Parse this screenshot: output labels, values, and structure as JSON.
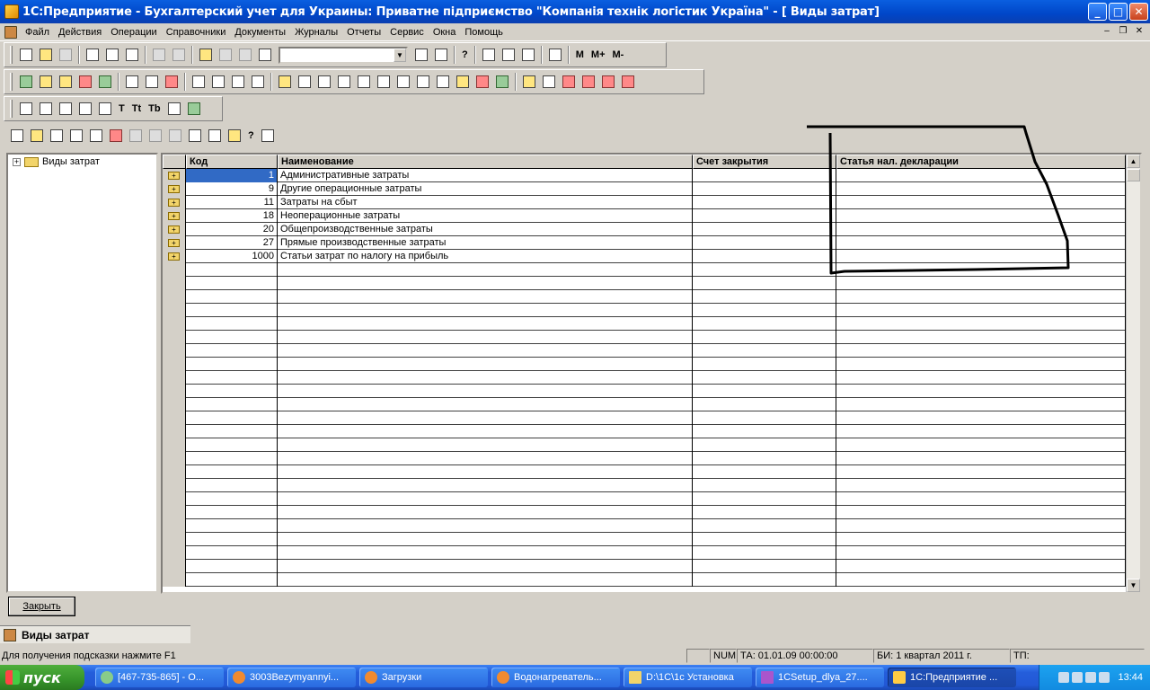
{
  "window": {
    "title": "1С:Предприятие - Бухгалтерский учет для Украины: Приватне підприємство \"Компанія  технік логістик  Україна\" - [ Виды затрат]",
    "min": "_",
    "max": "□",
    "close": "✕"
  },
  "menu": [
    "Файл",
    "Действия",
    "Операции",
    "Справочники",
    "Документы",
    "Журналы",
    "Отчеты",
    "Сервис",
    "Окна",
    "Помощь"
  ],
  "toolbar": {
    "m_label": "M",
    "mplus_label": "M+",
    "mminus_label": "M-",
    "help_label": "?",
    "text_labels": [
      "T",
      "Tt",
      "Tb"
    ]
  },
  "tree": {
    "root": "Виды затрат",
    "expander": "+"
  },
  "grid": {
    "columns": [
      "Код",
      "Наименование",
      "Счет закрытия",
      "Статья нал. декларации"
    ],
    "rows": [
      {
        "code": "1",
        "name": "Административные затраты",
        "account": "",
        "article": ""
      },
      {
        "code": "9",
        "name": "Другие операционные затраты",
        "account": "",
        "article": ""
      },
      {
        "code": "11",
        "name": "Затраты на сбыт",
        "account": "",
        "article": ""
      },
      {
        "code": "18",
        "name": "Неоперационные затраты",
        "account": "",
        "article": ""
      },
      {
        "code": "20",
        "name": "Общепроизводственные затраты",
        "account": "",
        "article": ""
      },
      {
        "code": "27",
        "name": "Прямые производственные затраты",
        "account": "",
        "article": ""
      },
      {
        "code": "1000",
        "name": "Статьи затрат по налогу на прибыль",
        "account": "",
        "article": ""
      }
    ]
  },
  "buttons": {
    "close": "Закрыть"
  },
  "window_tab": "Виды затрат",
  "status": {
    "hint": "Для получения подсказки нажмите F1",
    "num": "NUM",
    "ta": "ТА: 01.01.09  00:00:00",
    "bi": "БИ: 1 квартал 2011 г.",
    "tp": "ТП:"
  },
  "taskbar": {
    "start": "пуск",
    "tasks": [
      "[467-735-865] - О...",
      "3003Bezymyannyi...",
      "Загрузки",
      "Водонагреватель...",
      "D:\\1C\\1c Установка",
      "1CSetup_dlya_27....",
      "1С:Предприятие ..."
    ],
    "clock": "13:44"
  }
}
